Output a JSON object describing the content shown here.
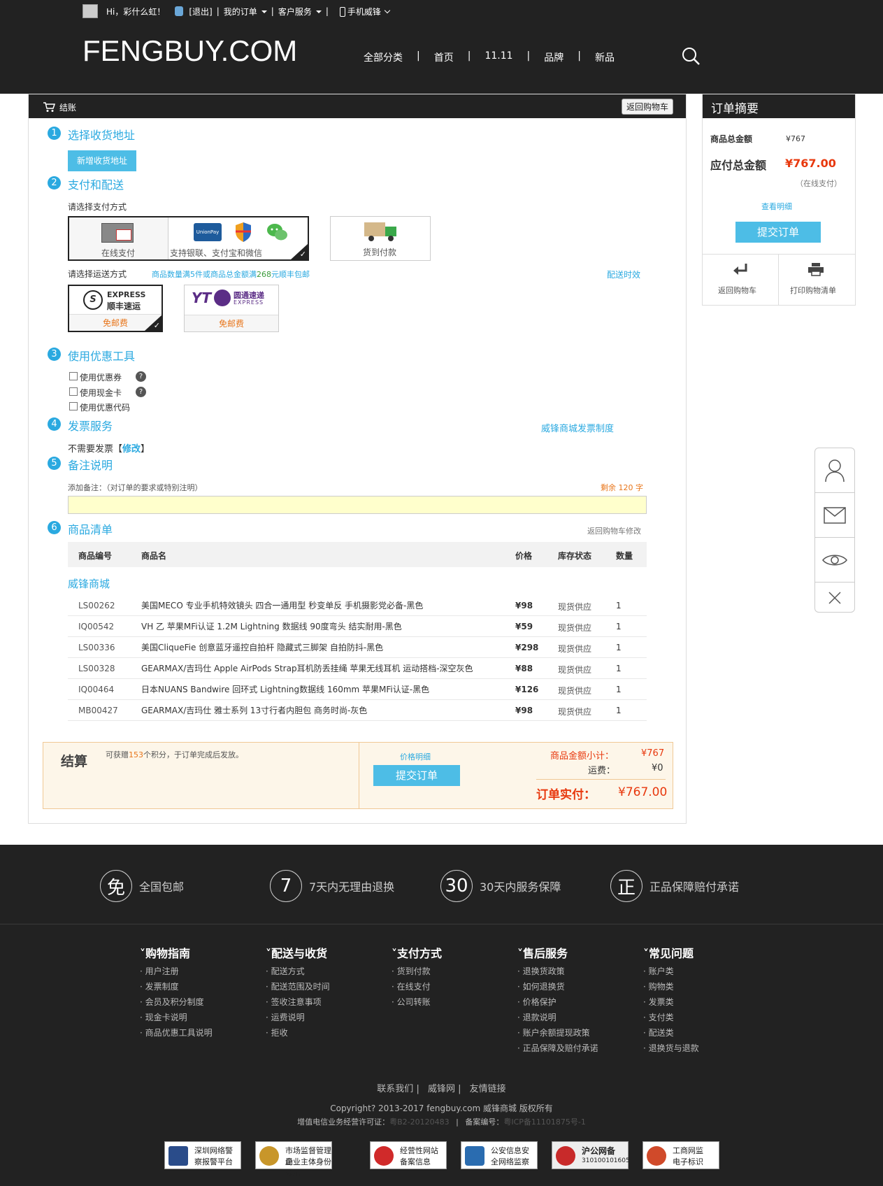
{
  "topbar": {
    "greeting": "Hi，彩什么虹！",
    "logout": "[退出]",
    "orders": "我的订单",
    "service": "客户服务",
    "mobile": "手机威锋",
    "sep": "|"
  },
  "logo": "FENGBUY.COM",
  "nav": [
    "全部分类",
    "首页",
    "11.11",
    "品牌",
    "新品"
  ],
  "checkout": {
    "title": "结账",
    "back_cart": "返回购物车"
  },
  "step1": {
    "num": "1",
    "title": "选择收货地址",
    "add_btn": "新增收货地址"
  },
  "step2": {
    "num": "2",
    "title": "支付和配送",
    "pay_label": "请选择支付方式",
    "online": "在线支付",
    "online_sub": "支持银联、支付宝和微信",
    "cod": "货到付款",
    "ship_label": "请选择运送方式",
    "ship_note_a": "商品数量满5件或商品总金额满",
    "ship_note_amt": "268",
    "ship_note_b": "元顺丰包邮",
    "ship_time": "配送时效",
    "sf_name": "EXPRESS",
    "sf_cn": "顺丰速运",
    "sf_fee": "免邮费",
    "yto_name": "圆通速递",
    "yto_en": "EXPRESS",
    "yto_fee": "免邮费",
    "unionpay": "UnionPay 银联"
  },
  "step3": {
    "num": "3",
    "title": "使用优惠工具",
    "opts": [
      "使用优惠券",
      "使用现金卡",
      "使用优惠代码"
    ]
  },
  "step4": {
    "num": "4",
    "title": "发票服务",
    "policy": "威锋商城发票制度",
    "invoice_a": "不需要发票【",
    "invoice_edit": "修改",
    "invoice_b": "】"
  },
  "step5": {
    "num": "5",
    "title": "备注说明",
    "note_label": "添加备注：（对订单的要求或特别注明）",
    "remaining": "剩余 120 字"
  },
  "step6": {
    "num": "6",
    "title": "商品清单",
    "back_edit": "返回购物车修改",
    "headers": [
      "商品编号",
      "商品名",
      "价格",
      "库存状态",
      "数量"
    ],
    "store": "威锋商城",
    "rows": [
      {
        "id": "LS00262",
        "name": "美国MECO 专业手机特效镜头 四合一通用型 秒变单反 手机摄影党必备-黑色",
        "price": "¥98",
        "stock": "现货供应",
        "qty": "1"
      },
      {
        "id": "IQ00542",
        "name": "VH 乙 苹果MFi认证 1.2M Lightning 数据线 90度弯头 结实耐用-黑色",
        "price": "¥59",
        "stock": "现货供应",
        "qty": "1"
      },
      {
        "id": "LS00336",
        "name": "美国CliqueFie 创意蓝牙遥控自拍杆 隐藏式三脚架 自拍防抖-黑色",
        "price": "¥298",
        "stock": "现货供应",
        "qty": "1"
      },
      {
        "id": "LS00328",
        "name": "GEARMAX/吉玛仕 Apple AirPods Strap耳机防丢挂绳 苹果无线耳机 运动搭档-深空灰色",
        "price": "¥88",
        "stock": "现货供应",
        "qty": "1"
      },
      {
        "id": "IQ00464",
        "name": "日本NUANS Bandwire 回环式 Lightning数据线 160mm 苹果MFi认证-黑色",
        "price": "¥126",
        "stock": "现货供应",
        "qty": "1"
      },
      {
        "id": "MB00427",
        "name": "GEARMAX/吉玛仕 雅士系列 13寸行者内胆包 商务时尚-灰色",
        "price": "¥98",
        "stock": "现货供应",
        "qty": "1"
      }
    ]
  },
  "settle": {
    "title": "结算",
    "points_a": "可获赠",
    "points": "153",
    "points_b": "个积分，于订单完成后发放。",
    "detail": "价格明细",
    "submit": "提交订单",
    "subtotal_label": "商品金额小计：",
    "subtotal": "¥767",
    "ship_label": "运费：",
    "ship": "¥0",
    "total_label": "订单实付：",
    "total": "¥767.00"
  },
  "summary": {
    "title": "订单摘要",
    "goods_label": "商品总金额",
    "goods": "¥767",
    "pay_label": "应付总金额",
    "pay": "¥767.00",
    "online": "（在线支付）",
    "detail": "查看明细",
    "submit": "提交订单",
    "back": "返回购物车",
    "print": "打印购物清单"
  },
  "guarantees": [
    {
      "icon": "免",
      "text": "全国包邮"
    },
    {
      "icon": "7",
      "text": "7天内无理由退换"
    },
    {
      "icon": "30",
      "text": "30天内服务保障"
    },
    {
      "icon": "正",
      "text": "正品保障赔付承诺"
    }
  ],
  "footer_cols": [
    {
      "title": "购物指南",
      "items": [
        "用户注册",
        "发票制度",
        "会员及积分制度",
        "现金卡说明",
        "商品优惠工具说明"
      ]
    },
    {
      "title": "配送与收货",
      "items": [
        "配送方式",
        "配送范围及时间",
        "签收注意事项",
        "运费说明",
        "拒收"
      ]
    },
    {
      "title": "支付方式",
      "items": [
        "货到付款",
        "在线支付",
        "公司转账"
      ]
    },
    {
      "title": "售后服务",
      "items": [
        "退换货政策",
        "如何退换货",
        "价格保护",
        "退款说明",
        "账户余额提现政策",
        "正品保障及赔付承诺"
      ]
    },
    {
      "title": "常见问题",
      "items": [
        "账户类",
        "购物类",
        "发票类",
        "支付类",
        "配送类",
        "退换货与退款"
      ]
    }
  ],
  "footer_links": [
    "联系我们",
    "威锋网",
    "友情链接"
  ],
  "copyright": "Copyright? 2013-2017 fengbuy.com 威锋商城 版权所有",
  "license_a": "增值电信业务经营许可证：",
  "license": "粤B2-20120483",
  "record_a": "备案编号：",
  "record": "粤ICP备11101875号-1",
  "badges": [
    {
      "a": "深圳网络警",
      "b": "察报警平台"
    },
    {
      "a": "市场监督管理局",
      "b": "企业主体身份公示"
    },
    {
      "a": "经营性网站",
      "b": "备案信息"
    },
    {
      "a": "公安信息安",
      "b": "全网络监察"
    },
    {
      "a": "沪公网备",
      "b": "310100101605"
    },
    {
      "a": "工商网监",
      "b": "电子标识"
    }
  ],
  "colors": {
    "accent": "#2aa9e0",
    "price": "#e8380d",
    "dark": "#222222"
  }
}
